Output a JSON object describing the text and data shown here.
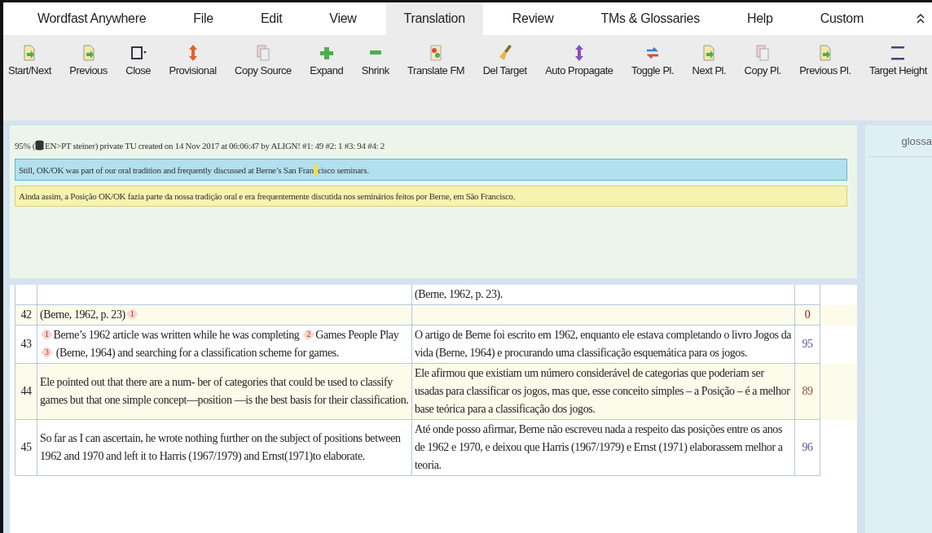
{
  "menu": [
    {
      "label": "Wordfast Anywhere",
      "selected": false
    },
    {
      "label": "File",
      "selected": false
    },
    {
      "label": "Edit",
      "selected": false
    },
    {
      "label": "View",
      "selected": false
    },
    {
      "label": "Translation",
      "selected": true
    },
    {
      "label": "Review",
      "selected": false
    },
    {
      "label": "TMs & Glossaries",
      "selected": false
    },
    {
      "label": "Help",
      "selected": false
    },
    {
      "label": "Custom",
      "selected": false
    }
  ],
  "toolbar": [
    "Start/Next",
    "Previous",
    "Close",
    "Provisional",
    "Copy Source",
    "Expand",
    "Shrink",
    "Translate FM",
    "Del Target",
    "Auto Propagate",
    "Toggle Pl.",
    "Next Pl.",
    "Copy Pl.",
    "Previous Pl.",
    "Target Height"
  ],
  "tm_panel": {
    "info_prefix": "95% (",
    "info_rest": "EN>PT steiner) private TU created on 14 Nov 2017 at 06:06:47 by ALIGN! #1: 49 #2: 1 #3: 94 #4: 2",
    "source_before_cursor": "Still, OK/OK was part of our oral tradition and frequently discussed at Berne’s San Fran",
    "source_after_cursor": "cisco seminars.",
    "target": "Ainda assim, a Posição OK/OK fazia parte da nossa tradição oral e era frequentemente discutida nos seminários feitos por Berne, em São Francisco."
  },
  "glossary_panel": {
    "title": "glossa"
  },
  "segments": [
    {
      "target": "(Berne, 1962, p. 23)."
    },
    {
      "number": "42",
      "source": [
        {
          "kind": "text",
          "text": "(Berne, 1962, p. 23)"
        },
        {
          "kind": "tag",
          "text": "1"
        }
      ],
      "score": "0",
      "color": "#7a1f1f"
    },
    {
      "number": "43",
      "source": [
        {
          "kind": "tag",
          "text": "1"
        },
        {
          "kind": "text",
          "text": "Berne’s 1962 article was written while he was completing "
        },
        {
          "kind": "tag",
          "text": "2"
        },
        {
          "kind": "text",
          "text": "Games People Play"
        },
        {
          "kind": "tag",
          "text": "3"
        },
        {
          "kind": "text",
          "text": " (Berne, 1964) and searching for a classification scheme for games."
        }
      ],
      "target": "O artigo de Berne foi escrito em 1962, enquanto ele estava completando o livro Jogos da vida (Berne, 1964) e procurando uma classificação esquemática para os jogos.",
      "score": "95",
      "color": "#6a4f9a"
    },
    {
      "number": "44",
      "source": [
        {
          "kind": "text",
          "text": "Ele pointed out that there are a num- ber of categories that could be used to classify games but that one simple concept—position —is the best basis for their classification."
        }
      ],
      "target": "Ele afirmou que existiam um número considerável de categorias que poderiam ser usadas para classificar os jogos, mas que, esse conceito simples – a Posição – é a melhor base teórica para a classificação dos jogos.",
      "score": "89",
      "color": "#8a5a3a"
    },
    {
      "number": "45",
      "source": [
        {
          "kind": "text",
          "text": "So far as I can ascertain, he wrote nothing further on the subject of positions between 1962 and 1970 and left it to Harris (1967/1979) and Ernst(1971)to elaborate."
        }
      ],
      "target": "Até onde posso afirmar, Berne não escreveu nada a respeito das posições entre os anos de 1962 e 1970, e deixou que Harris (1967/1979) e Ernst (1971) elaborassem melhor a teoria.",
      "score": "96",
      "color": "#6a4f9a"
    }
  ]
}
